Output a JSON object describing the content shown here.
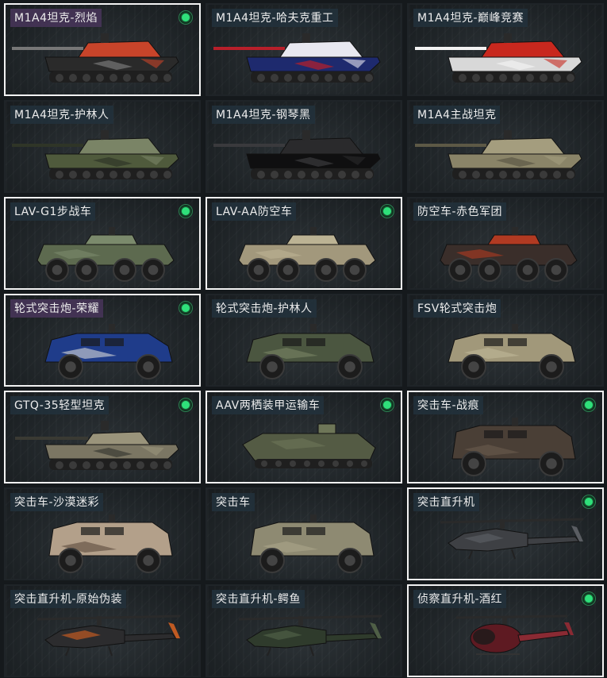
{
  "vehicles": [
    {
      "name": "M1A4坦克-烈焰",
      "icon": "tank-icon",
      "owned": true,
      "selected": true,
      "tag": "purple",
      "colors": [
        "#2a2a2a",
        "#c8442a",
        "#777"
      ]
    },
    {
      "name": "M1A4坦克-哈夫克重工",
      "icon": "tank-icon",
      "owned": false,
      "selected": false,
      "tag": "blue",
      "colors": [
        "#1e2a6e",
        "#e8e8f0",
        "#b81f2a"
      ]
    },
    {
      "name": "M1A4坦克-巅峰竞赛",
      "icon": "tank-icon",
      "owned": false,
      "selected": false,
      "tag": "blue",
      "colors": [
        "#d8d8d8",
        "#c8281e",
        "#f2f2f2"
      ]
    },
    {
      "name": "M1A4坦克-护林人",
      "icon": "tank-icon",
      "owned": false,
      "selected": false,
      "tag": "blue",
      "colors": [
        "#4f5a3c",
        "#7a8466",
        "#2f3527"
      ]
    },
    {
      "name": "M1A4坦克-钢琴黑",
      "icon": "tank-icon",
      "owned": false,
      "selected": false,
      "tag": "blue",
      "colors": [
        "#0f0f10",
        "#2a2a2c",
        "#3a3a3d"
      ]
    },
    {
      "name": "M1A4主战坦克",
      "icon": "tank-icon",
      "owned": false,
      "selected": false,
      "tag": "blue",
      "colors": [
        "#8a8468",
        "#a49d7e",
        "#5d5946"
      ]
    },
    {
      "name": "LAV-G1步战车",
      "icon": "ifv-icon",
      "owned": true,
      "selected": true,
      "tag": "blue",
      "colors": [
        "#5d6a4f",
        "#7b8a6c",
        "#2e2e2e"
      ]
    },
    {
      "name": "LAV-AA防空车",
      "icon": "ifv-icon",
      "owned": true,
      "selected": true,
      "tag": "blue",
      "colors": [
        "#a2987c",
        "#bcb394",
        "#2e2e2e"
      ]
    },
    {
      "name": "防空车-赤色军团",
      "icon": "ifv-icon",
      "owned": false,
      "selected": false,
      "tag": "blue",
      "colors": [
        "#3a2e2a",
        "#b13a22",
        "#2e2e2e"
      ]
    },
    {
      "name": "轮式突击炮-荣耀",
      "icon": "armored-car-icon",
      "owned": true,
      "selected": true,
      "tag": "purple",
      "colors": [
        "#1f3c8a",
        "#d8d8d8",
        "#2e2e2e"
      ]
    },
    {
      "name": "轮式突击炮-护林人",
      "icon": "armored-car-icon",
      "owned": false,
      "selected": false,
      "tag": "blue",
      "colors": [
        "#4b5640",
        "#7a8566",
        "#2e2e2e"
      ]
    },
    {
      "name": "FSV轮式突击炮",
      "icon": "armored-car-icon",
      "owned": false,
      "selected": false,
      "tag": "blue",
      "colors": [
        "#a1987a",
        "#c0b798",
        "#2e2e2e"
      ]
    },
    {
      "name": "GTQ-35轻型坦克",
      "icon": "light-tank-icon",
      "owned": true,
      "selected": true,
      "tag": "blue",
      "colors": [
        "#7b7663",
        "#9a947b",
        "#3a3a33"
      ]
    },
    {
      "name": "AAV两栖装甲运输车",
      "icon": "amphibious-apc-icon",
      "owned": true,
      "selected": true,
      "tag": "blue",
      "colors": [
        "#545b44",
        "#6e7658",
        "#2d2f25"
      ]
    },
    {
      "name": "突击车-战痕",
      "icon": "assault-vehicle-icon",
      "owned": true,
      "selected": true,
      "tag": "blue",
      "colors": [
        "#4a3f36",
        "#6b5c4e",
        "#2a2a2a"
      ]
    },
    {
      "name": "突击车-沙漠迷彩",
      "icon": "assault-vehicle-icon",
      "owned": false,
      "selected": false,
      "tag": "blue",
      "colors": [
        "#b3a08a",
        "#5a4a3c",
        "#2a2a2a"
      ]
    },
    {
      "name": "突击车",
      "icon": "assault-vehicle-icon",
      "owned": false,
      "selected": false,
      "tag": "blue",
      "colors": [
        "#8e8a72",
        "#aaa58b",
        "#2a2a2a"
      ]
    },
    {
      "name": "突击直升机",
      "icon": "attack-helicopter-icon",
      "owned": true,
      "selected": true,
      "tag": "blue",
      "colors": [
        "#3e4044",
        "#5a5d62",
        "#2a2a2a"
      ]
    },
    {
      "name": "突击直升机-原始伪装",
      "icon": "attack-helicopter-icon",
      "owned": false,
      "selected": false,
      "tag": "blue",
      "colors": [
        "#2c2c2e",
        "#c05a22",
        "#444"
      ]
    },
    {
      "name": "突击直升机-鳄鱼",
      "icon": "attack-helicopter-icon",
      "owned": false,
      "selected": false,
      "tag": "blue",
      "colors": [
        "#2f3b2c",
        "#4f5f46",
        "#222"
      ]
    },
    {
      "name": "侦察直升机-酒红",
      "icon": "scout-helicopter-icon",
      "owned": true,
      "selected": true,
      "tag": "blue",
      "colors": [
        "#5e1a22",
        "#8a2a33",
        "#2a2a2a"
      ]
    }
  ]
}
